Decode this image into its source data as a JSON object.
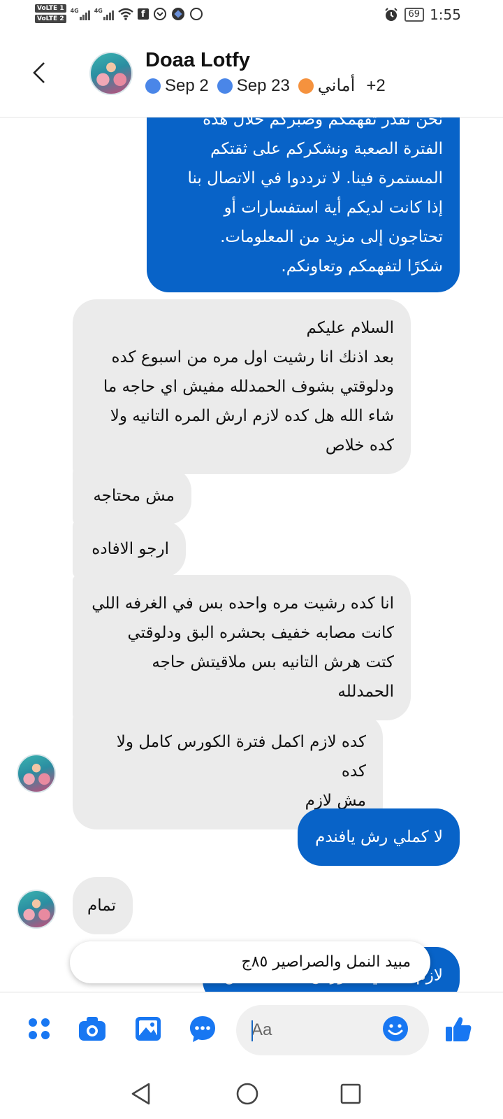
{
  "status_bar": {
    "volte1": "VoLTE 1",
    "volte2": "VoLTE 2",
    "net1": "4G",
    "net2": "4G",
    "battery": "69",
    "time": "1:55"
  },
  "header": {
    "contact_name": "Doaa Lotfy",
    "chips": [
      {
        "label": "Sep 2",
        "color": "#4a86e8"
      },
      {
        "label": "Sep 23",
        "color": "#4a86e8"
      },
      {
        "label": "أماني",
        "color": "#f5923e"
      }
    ],
    "more": "+2"
  },
  "messages": [
    {
      "dir": "out",
      "text": "نحن نقدر تفهمكم وصبركم خلال هذه\nالفترة الصعبة ونشكركم على ثقتكم\nالمستمرة فينا. لا ترددوا في الاتصال بنا\nإذا كانت لديكم أية استفسارات أو\nتحتاجون إلى مزيد من المعلومات.\nشكرًا لتفهمكم وتعاونكم."
    },
    {
      "dir": "in",
      "text": "السلام عليكم\nبعد اذنك انا رشيت اول مره من اسبوع كده\nودلوقتي بشوف الحمدلله مفيش اي حاجه ما\nشاء الله هل كده لازم ارش المره التانيه ولا\nكده خلاص"
    },
    {
      "dir": "in",
      "text": "مش محتاجه"
    },
    {
      "dir": "in",
      "text": "ارجو الافاده"
    },
    {
      "dir": "in",
      "text": "انا كده رشيت مره واحده بس في الغرفه اللي\nكانت مصابه خفيف بحشره البق ودلوقتي\nكتت هرش التانيه بس ملاقيتش حاجه\nالحمدلله"
    },
    {
      "dir": "in",
      "text": "كده لازم اكمل فترة الكورس كامل ولا كده\nمش لازم"
    },
    {
      "dir": "out",
      "text": "لا كملي رش يافندم"
    },
    {
      "dir": "in",
      "text": "تمام"
    },
    {
      "dir": "out",
      "text": "لازم تكملي الكورس لان فيه بيض"
    }
  ],
  "suggestion": "مبيد النمل والصراصير ٨٥ج",
  "composer": {
    "placeholder": "Aa",
    "icons": [
      "menu-dots-icon",
      "camera-icon",
      "gallery-icon",
      "chat-bubble-icon",
      "emoji-icon",
      "thumbs-up-icon"
    ]
  },
  "colors": {
    "accent": "#0863c8",
    "incoming_bubble": "#ebebeb",
    "icon_blue": "#1877f2"
  }
}
